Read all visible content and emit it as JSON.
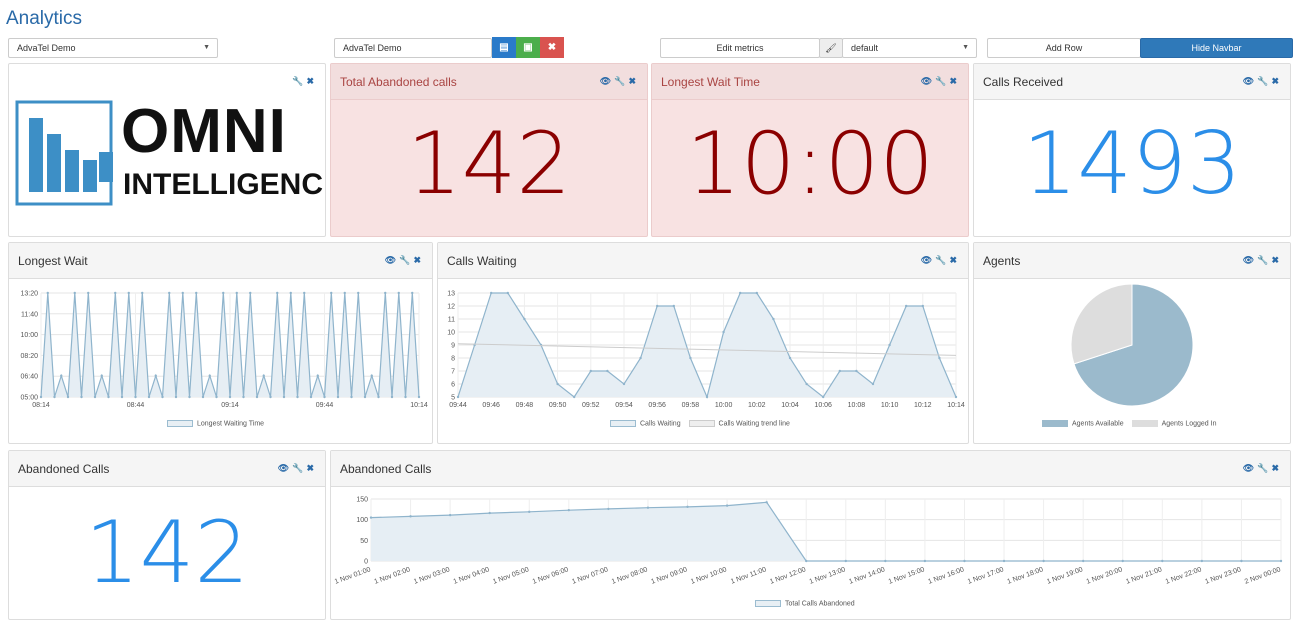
{
  "header": {
    "title": "Analytics"
  },
  "toolbar": {
    "left_select": "AdvaTel Demo",
    "dashboard_name": "AdvaTel Demo",
    "edit_metrics": "Edit metrics",
    "theme_select": "default",
    "add_row": "Add Row",
    "hide_navbar": "Hide Navbar"
  },
  "panels": {
    "total_abandoned": {
      "title": "Total Abandoned calls",
      "value": "142"
    },
    "longest_wait_time": {
      "title": "Longest Wait Time",
      "value": "10:00"
    },
    "calls_received": {
      "title": "Calls Received",
      "value": "1493"
    },
    "longest_wait": {
      "title": "Longest Wait",
      "legend": "Longest Waiting Time"
    },
    "calls_waiting": {
      "title": "Calls Waiting",
      "legend1": "Calls Waiting",
      "legend2": "Calls Waiting trend line"
    },
    "agents": {
      "title": "Agents",
      "legend1": "Agents Available",
      "legend2": "Agents Logged In"
    },
    "abandoned_calls_small": {
      "title": "Abandoned Calls",
      "value": "142"
    },
    "abandoned_calls_chart": {
      "title": "Abandoned Calls",
      "legend": "Total Calls Abandoned"
    }
  },
  "logo": {
    "word1": "OMNI",
    "word2": "INTELLIGENCE"
  },
  "colors": {
    "accent": "#2a6aa8",
    "bigblue": "#2b8ee8",
    "darkred": "#8b0000",
    "line": "#8fb4cc",
    "fill": "#e6eef4"
  },
  "chart_data": [
    {
      "type": "line",
      "yticks": [
        "05:00",
        "06:40",
        "08:20",
        "10:00",
        "11:40",
        "13:20"
      ],
      "xticks": [
        "08:14",
        "08:44",
        "09:14",
        "09:44",
        "10:14"
      ],
      "values": [
        5,
        13.3,
        5,
        6.7,
        5,
        13.3,
        5,
        13.3,
        5,
        6.7,
        5,
        13.3,
        5,
        13.3,
        5,
        13.3,
        5,
        6.7,
        5,
        13.3,
        5,
        13.3,
        5,
        13.3,
        5,
        6.7,
        5,
        13.3,
        5,
        13.3,
        5,
        13.3,
        5,
        6.7,
        5,
        13.3,
        5,
        13.3,
        5,
        13.3,
        5,
        6.7,
        5,
        13.3,
        5,
        13.3,
        5,
        13.3,
        5,
        6.7,
        5,
        13.3,
        5,
        13.3,
        5,
        13.3,
        5
      ],
      "ylim": [
        5,
        13.3
      ]
    },
    {
      "type": "area",
      "yticks": [
        "5",
        "6",
        "7",
        "8",
        "9",
        "10",
        "11",
        "12",
        "13"
      ],
      "xticks": [
        "09:44",
        "09:46",
        "09:48",
        "09:50",
        "09:52",
        "09:54",
        "09:56",
        "09:58",
        "10:00",
        "10:02",
        "10:04",
        "10:06",
        "10:08",
        "10:10",
        "10:12",
        "10:14"
      ],
      "values": [
        5,
        9,
        13,
        13,
        11,
        9,
        6,
        5,
        7,
        7,
        6,
        8,
        12,
        12,
        8,
        5,
        10,
        13,
        13,
        11,
        8,
        6,
        5,
        7,
        7,
        6,
        9,
        12,
        12,
        8,
        5
      ],
      "trend": [
        9.1,
        8.2
      ],
      "ylim": [
        5,
        13
      ]
    },
    {
      "type": "pie",
      "series": [
        {
          "name": "Agents Available",
          "value": 70
        },
        {
          "name": "Agents Logged In",
          "value": 30
        }
      ]
    },
    {
      "type": "area",
      "yticks": [
        "0",
        "50",
        "100",
        "150"
      ],
      "xticks": [
        "1 Nov 01:00",
        "1 Nov 02:00",
        "1 Nov 03:00",
        "1 Nov 04:00",
        "1 Nov 05:00",
        "1 Nov 06:00",
        "1 Nov 07:00",
        "1 Nov 08:00",
        "1 Nov 09:00",
        "1 Nov 10:00",
        "1 Nov 11:00",
        "1 Nov 12:00",
        "1 Nov 13:00",
        "1 Nov 14:00",
        "1 Nov 15:00",
        "1 Nov 16:00",
        "1 Nov 17:00",
        "1 Nov 18:00",
        "1 Nov 19:00",
        "1 Nov 20:00",
        "1 Nov 21:00",
        "1 Nov 22:00",
        "1 Nov 23:00",
        "2 Nov 00:00"
      ],
      "values": [
        105,
        108,
        111,
        116,
        119,
        123,
        126,
        129,
        131,
        134,
        142,
        0,
        0,
        0,
        0,
        0,
        0,
        0,
        0,
        0,
        0,
        0,
        0,
        0
      ],
      "ylim": [
        0,
        150
      ]
    }
  ]
}
